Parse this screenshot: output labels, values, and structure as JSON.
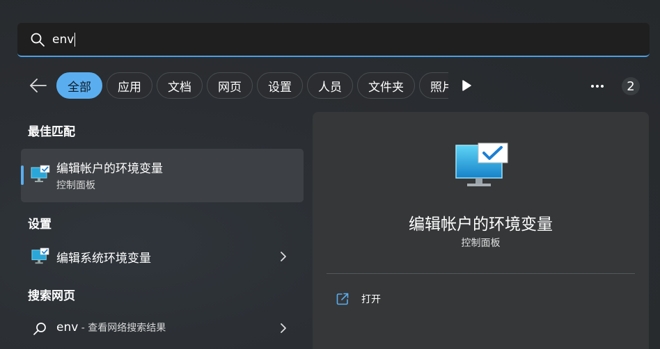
{
  "search": {
    "query": "env"
  },
  "filters": {
    "chips": [
      "全部",
      "应用",
      "文档",
      "网页",
      "设置",
      "人员",
      "文件夹",
      "照片"
    ],
    "active_index": 0,
    "count_badge": "2"
  },
  "results": {
    "best_match_heading": "最佳匹配",
    "best_match": {
      "name": "编辑帐户的环境变量",
      "subtitle": "控制面板"
    },
    "settings_heading": "设置",
    "settings_item": {
      "name": "编辑系统环境变量"
    },
    "web_heading": "搜索网页",
    "web_item": {
      "query": "env",
      "hint": " - 查看网络搜索结果"
    }
  },
  "detail": {
    "title": "编辑帐户的环境变量",
    "subtitle": "控制面板",
    "actions": [
      {
        "label": "打开",
        "icon": "open-external-icon"
      }
    ]
  },
  "colors": {
    "accent": "#5aaef0",
    "background": "#2a2d31",
    "panel": "#353739"
  }
}
